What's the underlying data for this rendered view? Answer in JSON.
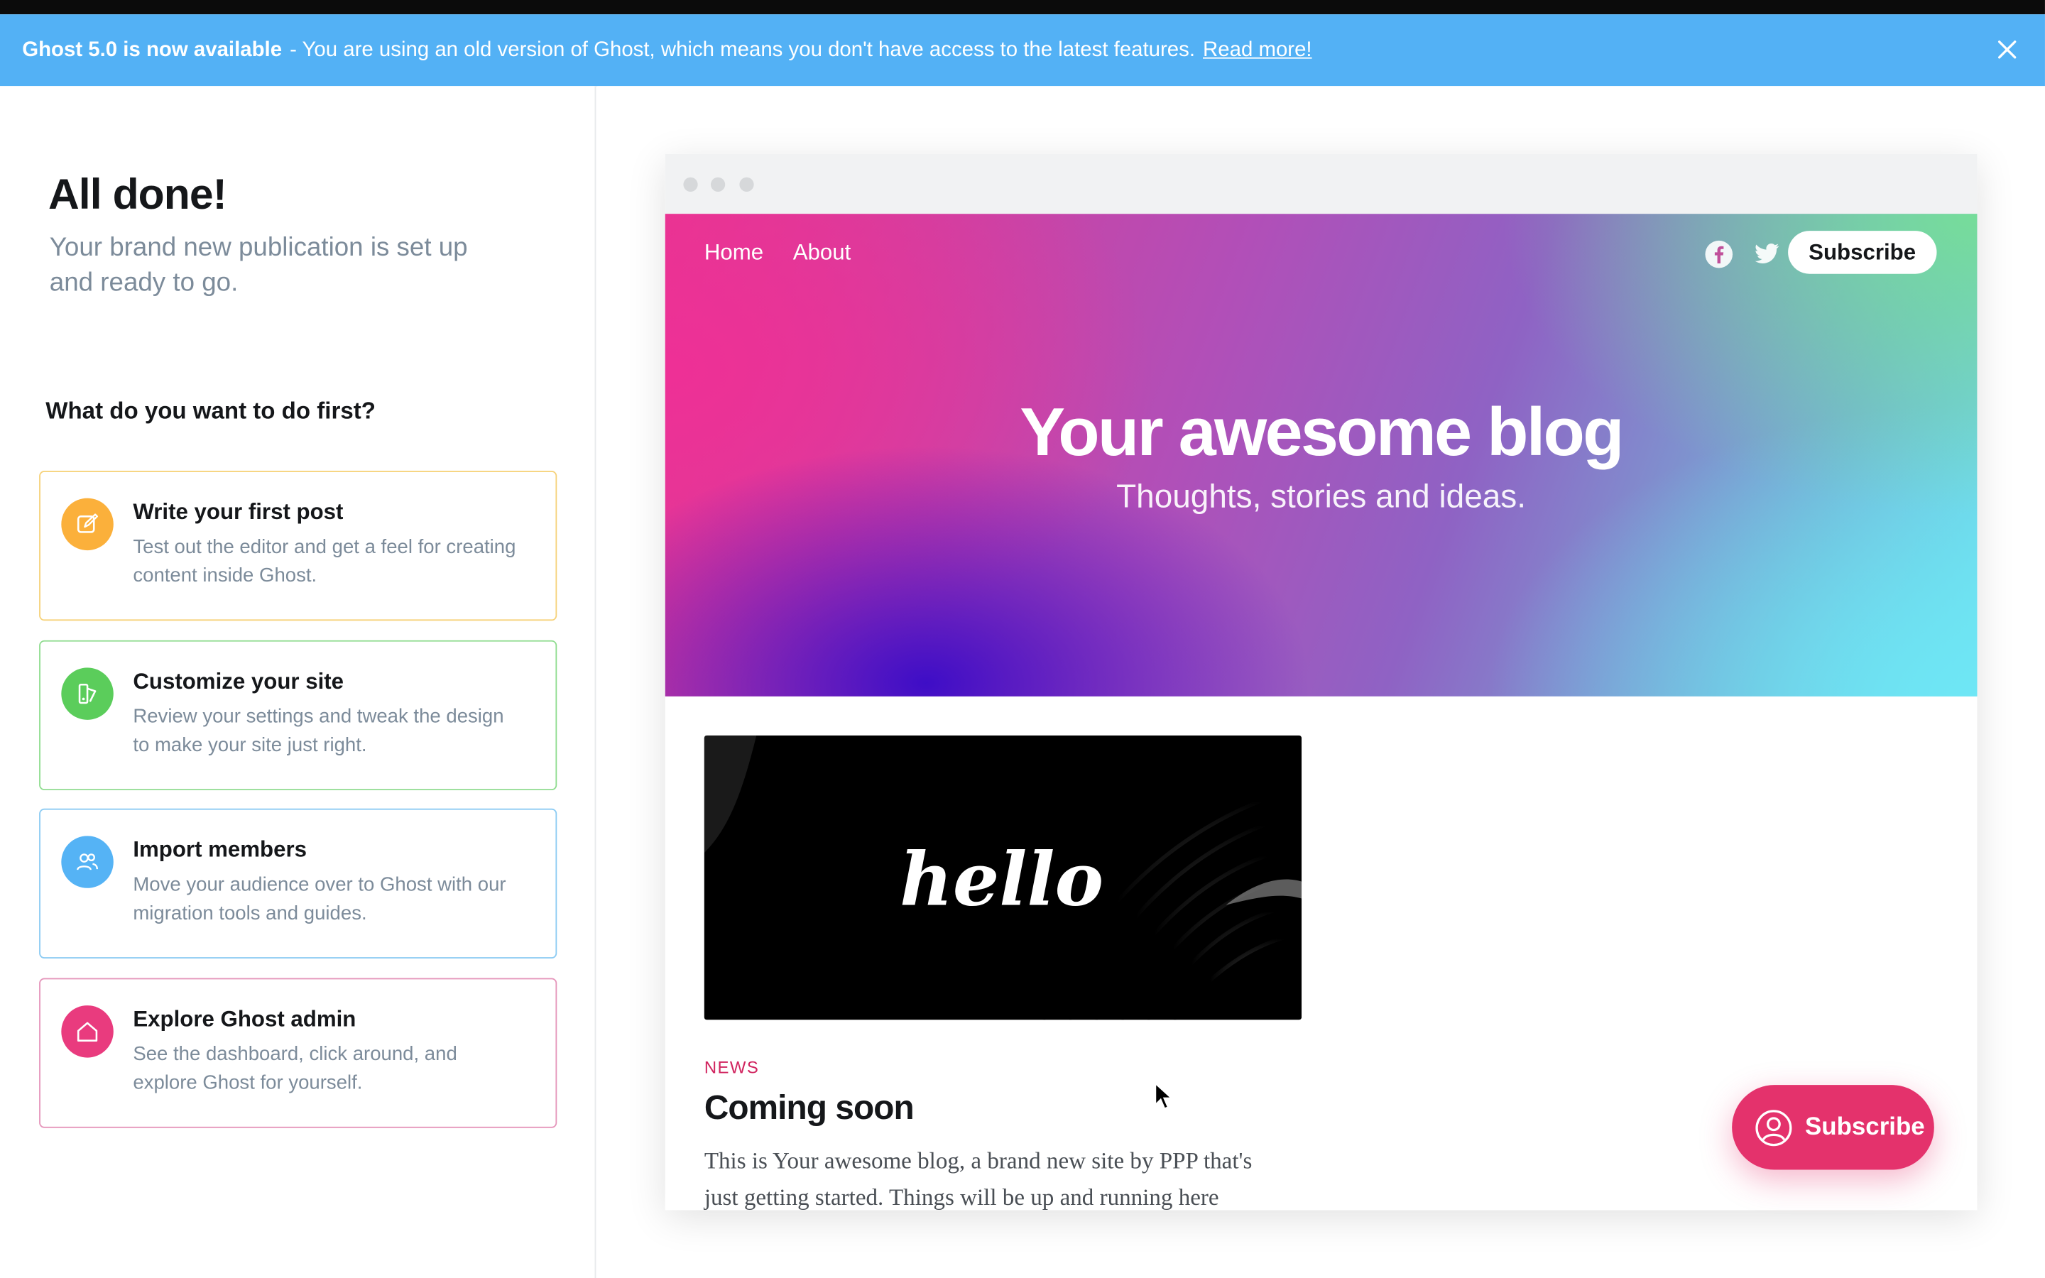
{
  "banner": {
    "strong": "Ghost 5.0 is now available",
    "text": "- You are using an old version of Ghost, which means you don't have access to the latest features.",
    "link": "Read more!",
    "color": "#53b1f5"
  },
  "onboarding": {
    "title": "All done!",
    "subtitle": "Your brand new publication is set up and ready to go.",
    "question": "What do you want to do first?",
    "cards": [
      {
        "title": "Write your first post",
        "desc": "Test out the editor and get a feel for creating content inside Ghost.",
        "icon": "pencil-edit-icon",
        "color": "#fbb03b"
      },
      {
        "title": "Customize your site",
        "desc": "Review your settings and tweak the design to make your site just right.",
        "icon": "paint-brush-icon",
        "color": "#5bcd5b"
      },
      {
        "title": "Import members",
        "desc": "Move your audience over to Ghost with our migration tools and guides.",
        "icon": "members-icon",
        "color": "#55b3f5"
      },
      {
        "title": "Explore Ghost admin",
        "desc": "See the dashboard, click around, and explore Ghost for yourself.",
        "icon": "home-icon",
        "color": "#e93b7e"
      }
    ]
  },
  "preview": {
    "nav": [
      "Home",
      "About"
    ],
    "subscribe_label": "Subscribe",
    "blog_title": "Your awesome blog",
    "blog_description": "Thoughts, stories and ideas.",
    "post": {
      "image_text": "hello",
      "tag": "NEWS",
      "title": "Coming soon",
      "excerpt": "This is Your awesome blog, a brand new site by PPP that's just getting started. Things will be up and running here"
    },
    "portal_label": "Subscribe"
  }
}
